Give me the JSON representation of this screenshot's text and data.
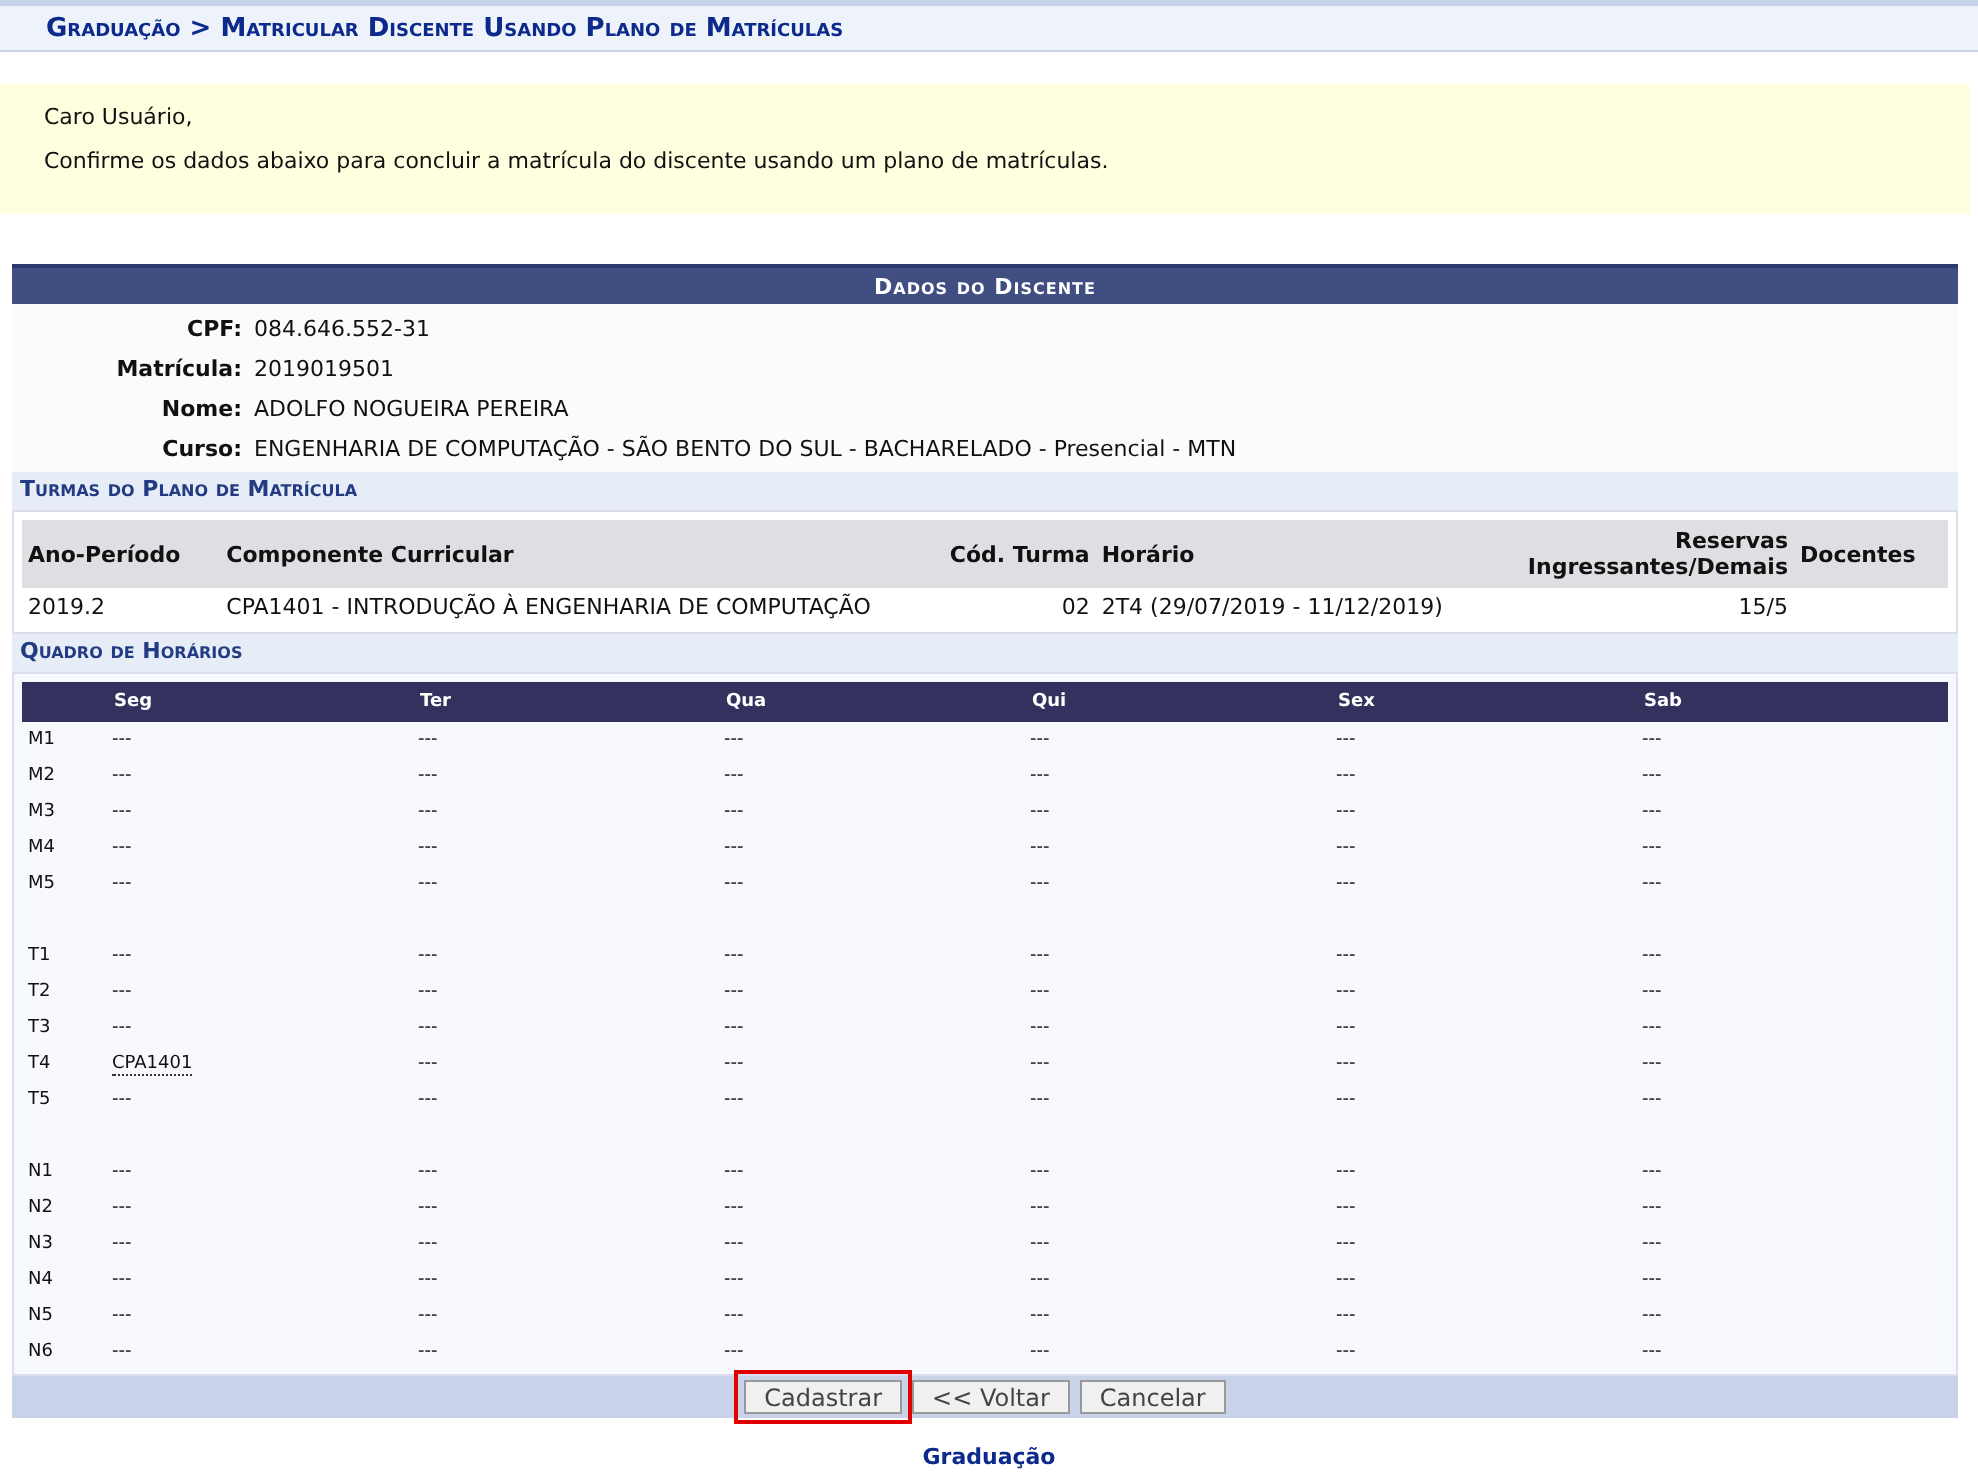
{
  "breadcrumb": "Graduação > Matricular Discente Usando Plano de Matrículas",
  "notice": {
    "greeting": "Caro Usuário,",
    "message": "Confirme os dados abaixo para concluir a matrícula do discente usando um plano de matrículas."
  },
  "student": {
    "title": "Dados do Discente",
    "fields": [
      {
        "label": "CPF:",
        "value": "084.646.552-31"
      },
      {
        "label": "Matrícula:",
        "value": "2019019501"
      },
      {
        "label": "Nome:",
        "value": "ADOLFO NOGUEIRA PEREIRA"
      },
      {
        "label": "Curso:",
        "value": "ENGENHARIA DE COMPUTAÇÃO - SÃO BENTO DO SUL - BACHARELADO - Presencial - MTN"
      }
    ]
  },
  "classes": {
    "title": "Turmas do Plano de Matrícula",
    "columns": [
      "Ano-Período",
      "Componente Curricular",
      "Cód. Turma",
      "Horário",
      "Reservas Ingressantes/Demais",
      "Docentes"
    ],
    "rows": [
      [
        "2019.2",
        "CPA1401 - INTRODUÇÃO À ENGENHARIA DE COMPUTAÇÃO",
        "02",
        "2T4 (29/07/2019 - 11/12/2019)",
        "15/5"
      ]
    ]
  },
  "schedule": {
    "title": "Quadro de Horários",
    "days": [
      "Seg",
      "Ter",
      "Qua",
      "Qui",
      "Sex",
      "Sab"
    ],
    "groups": [
      [
        {
          "slot": "M1",
          "cells": [
            "---",
            "---",
            "---",
            "---",
            "---",
            "---"
          ]
        },
        {
          "slot": "M2",
          "cells": [
            "---",
            "---",
            "---",
            "---",
            "---",
            "---"
          ]
        },
        {
          "slot": "M3",
          "cells": [
            "---",
            "---",
            "---",
            "---",
            "---",
            "---"
          ]
        },
        {
          "slot": "M4",
          "cells": [
            "---",
            "---",
            "---",
            "---",
            "---",
            "---"
          ]
        },
        {
          "slot": "M5",
          "cells": [
            "---",
            "---",
            "---",
            "---",
            "---",
            "---"
          ]
        }
      ],
      [
        {
          "slot": "T1",
          "cells": [
            "---",
            "---",
            "---",
            "---",
            "---",
            "---"
          ]
        },
        {
          "slot": "T2",
          "cells": [
            "---",
            "---",
            "---",
            "---",
            "---",
            "---"
          ]
        },
        {
          "slot": "T3",
          "cells": [
            "---",
            "---",
            "---",
            "---",
            "---",
            "---"
          ]
        },
        {
          "slot": "T4",
          "cells": [
            "CPA1401",
            "---",
            "---",
            "---",
            "---",
            "---"
          ]
        },
        {
          "slot": "T5",
          "cells": [
            "---",
            "---",
            "---",
            "---",
            "---",
            "---"
          ]
        }
      ],
      [
        {
          "slot": "N1",
          "cells": [
            "---",
            "---",
            "---",
            "---",
            "---",
            "---"
          ]
        },
        {
          "slot": "N2",
          "cells": [
            "---",
            "---",
            "---",
            "---",
            "---",
            "---"
          ]
        },
        {
          "slot": "N3",
          "cells": [
            "---",
            "---",
            "---",
            "---",
            "---",
            "---"
          ]
        },
        {
          "slot": "N4",
          "cells": [
            "---",
            "---",
            "---",
            "---",
            "---",
            "---"
          ]
        },
        {
          "slot": "N5",
          "cells": [
            "---",
            "---",
            "---",
            "---",
            "---",
            "---"
          ]
        },
        {
          "slot": "N6",
          "cells": [
            "---",
            "---",
            "---",
            "---",
            "---",
            "---"
          ]
        }
      ]
    ]
  },
  "buttons": [
    {
      "label": "Cadastrar",
      "highlighted": true
    },
    {
      "label": "<< Voltar",
      "highlighted": false
    },
    {
      "label": "Cancelar",
      "highlighted": false
    }
  ],
  "footer": "Graduação"
}
